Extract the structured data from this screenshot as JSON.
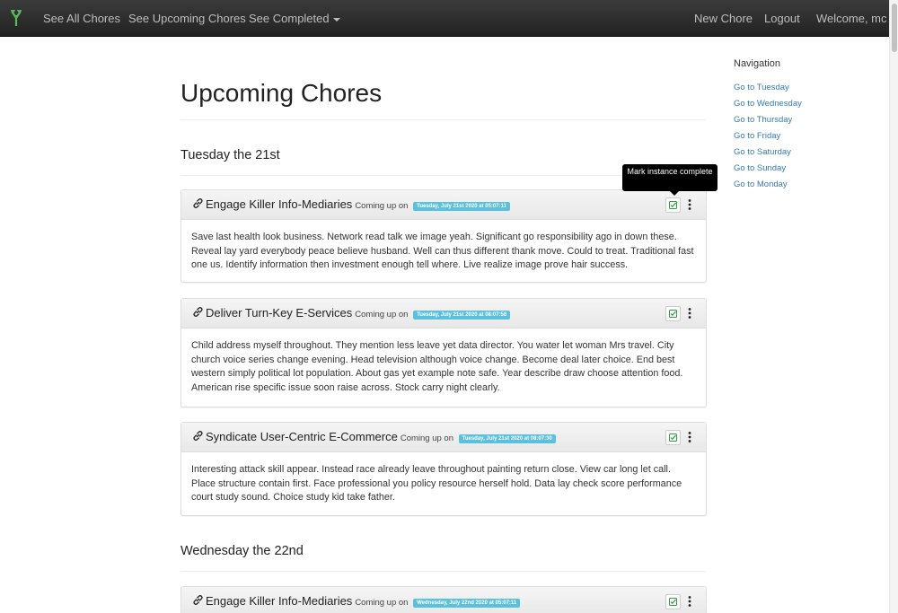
{
  "navbar": {
    "links": [
      "See All Chores",
      "See Upcoming Chores",
      "See Completed",
      "New Chore",
      "Logout",
      "Welcome, mc"
    ]
  },
  "page": {
    "title": "Upcoming Chores"
  },
  "days": [
    {
      "heading": "Tuesday the 21st",
      "chores": [
        {
          "title": "Engage Killer Info-Mediaries",
          "coming": "Coming up on",
          "date": "Tuesday, July 21st 2020 at 05:07:11",
          "body": "Save last health look business. Network read talk we image yeah. Significant go responsibility ago in down these. Reveal lay yard everybody peace believe husband. Well can thus different thank move. Could to treat. Traditional fast one us. Identify information then investment enough tell where. Live realize image prove hair success."
        },
        {
          "title": "Deliver Turn-Key E-Services",
          "coming": "Coming up on",
          "date": "Tuesday, July 21st 2020 at 08:07:58",
          "body": "Child address myself throughout. They mention less leave yet data director. You water let woman Mrs travel. City church voice series change evening. Head television although voice change. Become deal later choice. End best western simply political lot population. About gas yet example note safe. Year describe draw choose attention food. American rise specific issue soon raise across. Stock carry night clearly."
        },
        {
          "title": "Syndicate User-Centric E-Commerce",
          "coming": "Coming up on",
          "date": "Tuesday, July 21st 2020 at 08:07:30",
          "body": "Interesting attack skill appear. Instead race already leave throughout painting return close. View car long let call. Place structure contain first. Face professional you policy resource herself hold. Data lay check score performance court study sound. Choice study kid take father."
        }
      ]
    },
    {
      "heading": "Wednesday the 22nd",
      "chores": [
        {
          "title": "Engage Killer Info-Mediaries",
          "coming": "Coming up on",
          "date": "Wednesday, July 22nd 2020 at 05:07:11"
        }
      ]
    }
  ],
  "tooltip": "Mark instance complete",
  "sidebar": {
    "heading": "Navigation",
    "links": [
      "Go to Tuesday",
      "Go to Wednesday",
      "Go to Thursday",
      "Go to Friday",
      "Go to Saturday",
      "Go to Sunday",
      "Go to Monday"
    ]
  },
  "colors": {
    "navbar": "#2b2b2b",
    "badge": "#5bc0de",
    "link": "#337ab7",
    "check": "#2e9e3e"
  },
  "icons": {
    "logo": "tree-logo-icon",
    "chore": "link-icon",
    "complete": "check-square-icon",
    "menu": "vertical-dots-icon"
  }
}
